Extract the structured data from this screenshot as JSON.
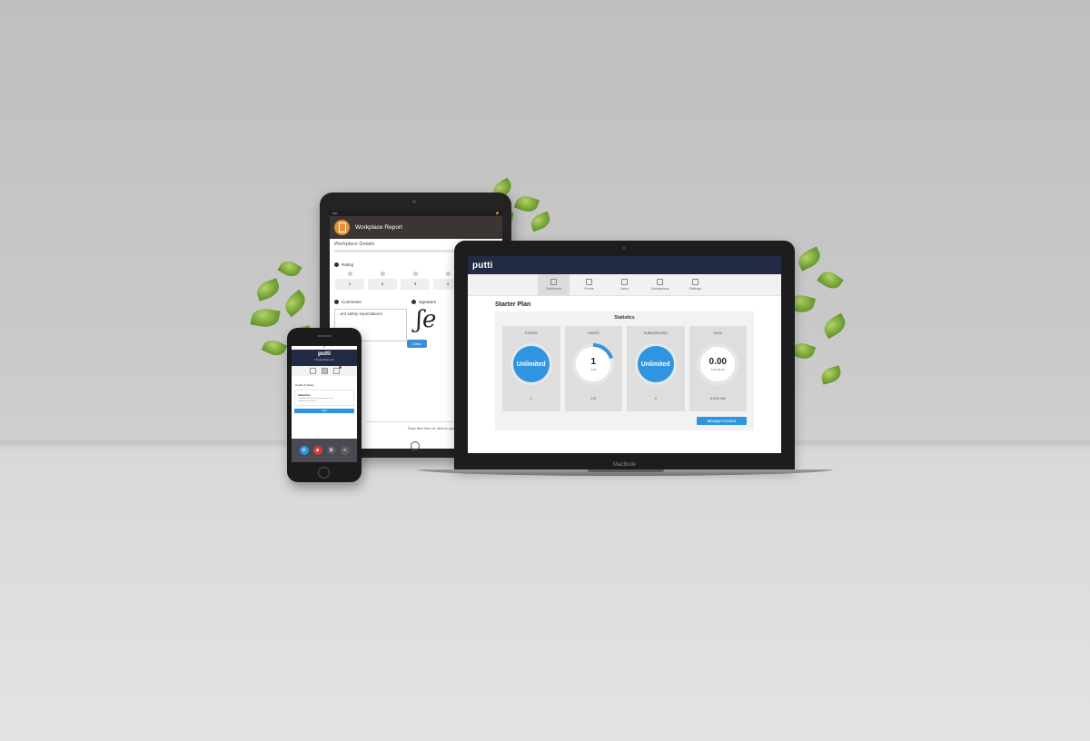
{
  "tablet": {
    "header_title": "Workplace Report",
    "subtitle": "Workplace Details",
    "rating_label": "Rating",
    "rating_options": [
      "1",
      "2",
      "3",
      "4"
    ],
    "comments_label": "Comments",
    "comments_value": "...ent safety expectations",
    "signature_label": "Signature",
    "clear_button": "Clear",
    "drop_text": "Drop files here or click to upload."
  },
  "laptop": {
    "brand": "MacBook",
    "logo": "putti",
    "tabs": [
      {
        "label": "Dashboard",
        "icon": "chart-icon"
      },
      {
        "label": "Forms",
        "icon": "clipboard-icon"
      },
      {
        "label": "Users",
        "icon": "users-icon"
      },
      {
        "label": "Submissions",
        "icon": "check-clipboard-icon"
      },
      {
        "label": "Settings",
        "icon": "tools-icon"
      }
    ],
    "plan_title": "Starter Plan",
    "stats_title": "Statistics",
    "cards": [
      {
        "title": "FORMS",
        "center": "Unlimited",
        "center_sub": "",
        "footer": "1"
      },
      {
        "title": "USERS",
        "center": "1",
        "center_sub": "4 left",
        "footer": "1/5"
      },
      {
        "title": "SUBMISSIONS",
        "center": "Unlimited",
        "center_sub": "",
        "footer": "9"
      },
      {
        "title": "DATA",
        "center": "0.00",
        "center_sub": "5.00 GB left",
        "footer": "0.003 GB"
      }
    ],
    "users_used_fraction": 0.2,
    "manage_button": "Manage Account"
  },
  "phone": {
    "logo": "putti",
    "email": "mike@puttiapp.com",
    "category": "Health & Safety",
    "card_title": "Induction",
    "card_desc": "Complete before commencing any work",
    "card_meta": "Updated 28 Jul 2020",
    "start_button": "Start"
  }
}
